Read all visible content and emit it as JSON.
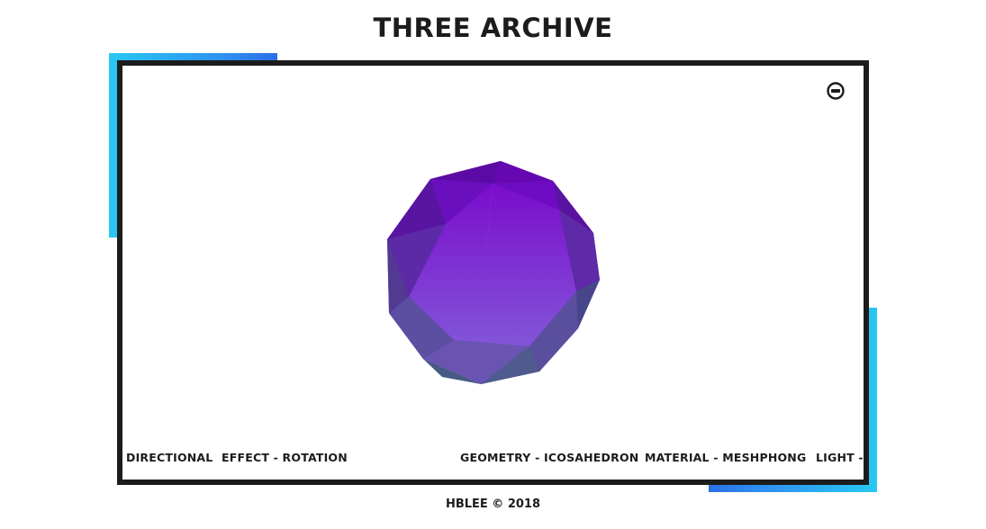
{
  "header": {
    "title": "THREE ARCHIVE"
  },
  "viewer": {
    "toggle_icon": "minus-circle-icon",
    "object_color": "#7a1fd0",
    "accent_color": "#28c8f2"
  },
  "info_bar": {
    "items": [
      "DIRECTIONAL",
      "EFFECT - ROTATION",
      "GEOMETRY - ICOSAHEDRON",
      "MATERIAL - MESHPHONG",
      "LIGHT -"
    ]
  },
  "footer": {
    "text": "HBLEE © 2018"
  }
}
